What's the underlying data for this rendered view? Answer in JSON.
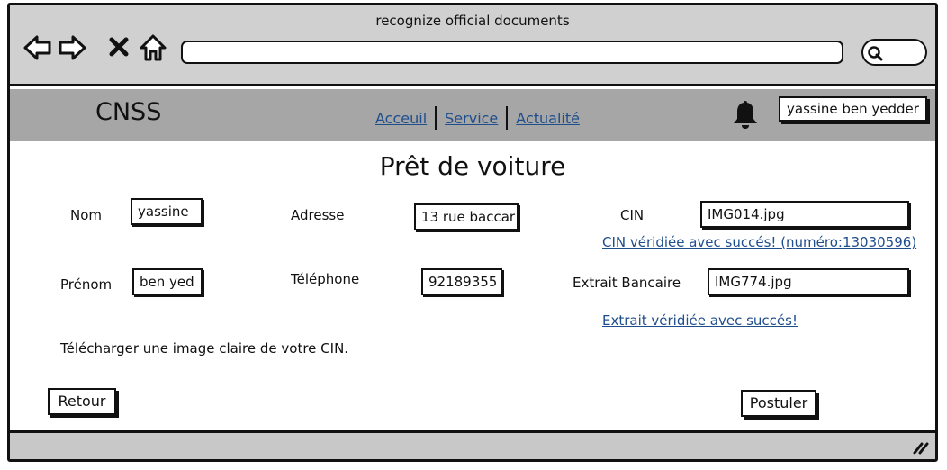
{
  "browser": {
    "window_title": "recognize official  documents",
    "address": "",
    "search_icon": "search-icon"
  },
  "header": {
    "logo": "CNSS",
    "nav": [
      {
        "label": "Acceuil"
      },
      {
        "label": "Service"
      },
      {
        "label": "Actualité"
      }
    ],
    "bell_icon": "bell-icon",
    "user": "yassine ben yedder"
  },
  "form": {
    "title": "Prêt de voiture",
    "nom": {
      "label": "Nom",
      "value": "yassine"
    },
    "prenom": {
      "label": "Prénom",
      "value": "ben yed"
    },
    "adresse": {
      "label": "Adresse",
      "value": "13 rue baccar"
    },
    "telephone": {
      "label": "Téléphone",
      "value": "92189355"
    },
    "cin": {
      "label": "CIN",
      "value": "IMG014.jpg",
      "status": "CIN véridiée avec succés! (numéro:13030596)"
    },
    "extrait": {
      "label": "Extrait Bancaire",
      "value": "IMG774.jpg",
      "status": "Extrait véridiée avec succés! "
    },
    "hint": "Télécharger une image claire de votre CIN."
  },
  "actions": {
    "back": "Retour",
    "submit": "Postuler"
  },
  "colors": {
    "chrome_bg": "#d0d0d0",
    "header_bg": "#a6a6a6",
    "link": "#1f4e8c"
  }
}
